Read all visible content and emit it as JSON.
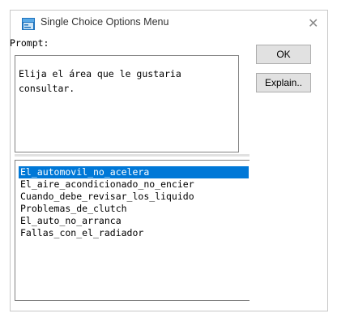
{
  "window": {
    "title": "Single Choice Options Menu",
    "close_glyph": "✕",
    "icon": "app-dialog-icon"
  },
  "prompt": {
    "label": "Prompt:",
    "text": "Elija el área que le gustaria\nconsultar."
  },
  "buttons": {
    "ok_label": "OK",
    "explain_label": "Explain.."
  },
  "options": {
    "selected_index": 0,
    "items": [
      "El_automovil_no_acelera",
      "El_aire_acondicionado_no_encier",
      "Cuando_debe_revisar_los_liquido",
      "Problemas_de_clutch",
      "El_auto_no_arranca",
      "Fallas_con_el_radiador"
    ]
  },
  "colors": {
    "selection": "#0078d7",
    "dialog_background": "#f0f0f0"
  }
}
